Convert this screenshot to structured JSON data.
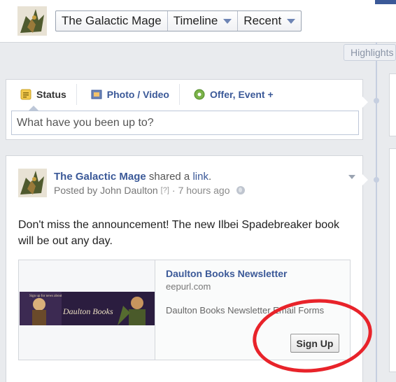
{
  "header": {
    "crumbs": [
      {
        "label": "The Galactic Mage"
      },
      {
        "label": "Timeline"
      },
      {
        "label": "Recent"
      }
    ],
    "highlights_label": "Highlights"
  },
  "composer": {
    "tabs": [
      {
        "label": "Status",
        "icon": "status-icon"
      },
      {
        "label": "Photo / Video",
        "icon": "photo-video-icon"
      },
      {
        "label": "Offer, Event +",
        "icon": "offer-event-icon"
      }
    ],
    "placeholder": "What have you been up to?"
  },
  "post": {
    "page_name": "The Galactic Mage",
    "action_text": "shared a",
    "link_word": "link",
    "posted_by": "Posted by John Daulton",
    "help_mark": "[?]",
    "time": "7 hours ago",
    "separator": "·",
    "message": "Don't miss the announcement! The new Ilbei Spadebreaker book will be out any day.",
    "share": {
      "title": "Daulton Books Newsletter",
      "domain": "eepurl.com",
      "description": "Daulton Books Newsletter Email Forms",
      "button_label": "Sign Up",
      "banner_small_text": "Sign up for news about",
      "banner_logo_text": "Daulton Books"
    }
  },
  "colors": {
    "link_blue": "#3b5998",
    "annotation_red": "#e8232a",
    "timeline_spine": "#c6cfe0"
  }
}
